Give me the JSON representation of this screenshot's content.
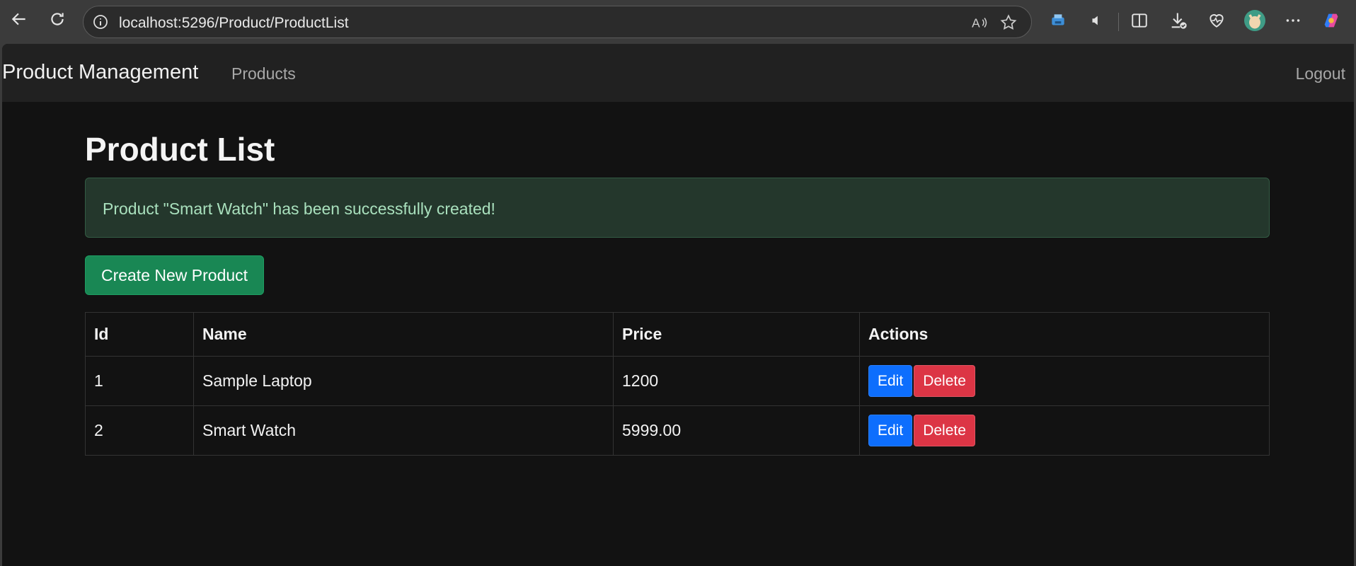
{
  "browser": {
    "url": "localhost:5296/Product/ProductList",
    "icons": [
      "back-arrow-icon",
      "refresh-icon",
      "info-icon",
      "read-aloud-icon",
      "favorite-star-icon",
      "extension-icon",
      "sound-icon",
      "split-screen-icon",
      "download-icon",
      "health-icon",
      "profile-avatar",
      "more-icon",
      "copilot-icon"
    ]
  },
  "navbar": {
    "brand": "Product Management",
    "link_products": "Products",
    "logout": "Logout"
  },
  "main": {
    "title": "Product List",
    "alert_message": "Product \"Smart Watch\" has been successfully created!",
    "create_button": "Create New Product"
  },
  "table": {
    "headers": [
      "Id",
      "Name",
      "Price",
      "Actions"
    ],
    "rows": [
      {
        "id": "1",
        "name": "Sample Laptop",
        "price": "1200",
        "edit": "Edit",
        "delete": "Delete"
      },
      {
        "id": "2",
        "name": "Smart Watch",
        "price": "5999.00",
        "edit": "Edit",
        "delete": "Delete"
      }
    ]
  },
  "colors": {
    "page_bg": "#121212",
    "navbar_bg": "#212121",
    "success": "#198754",
    "primary": "#0d6efd",
    "danger": "#dc3545"
  }
}
